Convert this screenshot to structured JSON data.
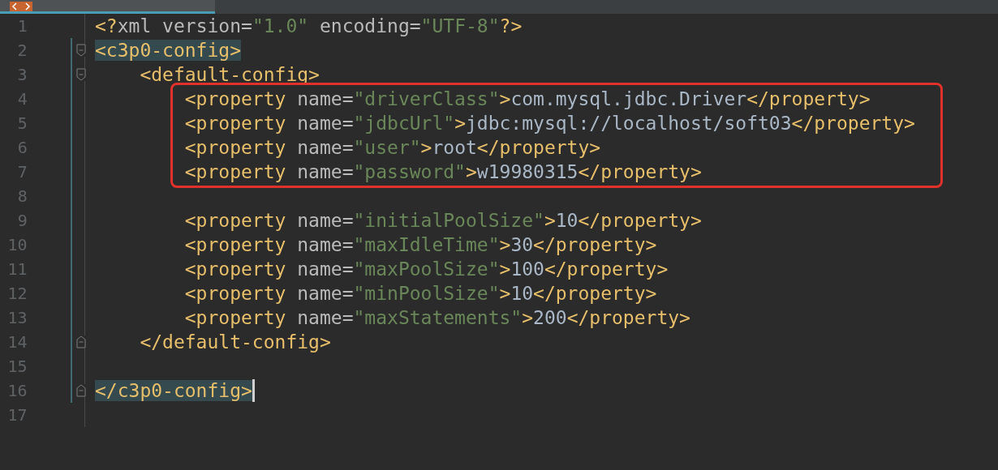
{
  "tab": {
    "selected": true
  },
  "lines": [
    {
      "number": "1",
      "tokens": [
        {
          "kind": "tag",
          "text": "<?"
        },
        {
          "kind": "attr",
          "text": "xml version="
        },
        {
          "kind": "string",
          "text": "\"1.0\""
        },
        {
          "kind": "attr",
          "text": " encoding="
        },
        {
          "kind": "string",
          "text": "\"UTF-8\""
        },
        {
          "kind": "tag",
          "text": "?>"
        }
      ]
    },
    {
      "number": "2",
      "kind": "fold_start",
      "highlighted": true,
      "tokens": [
        {
          "kind": "tag",
          "text": "<c3p0-config>"
        }
      ]
    },
    {
      "number": "3",
      "kind": "fold_start",
      "tokens": [
        {
          "kind": "tag",
          "text": "    <default-config>"
        }
      ]
    },
    {
      "number": "4",
      "boxed": true,
      "tokens": [
        {
          "kind": "tag",
          "text": "        <property"
        },
        {
          "kind": "attr",
          "text": " name="
        },
        {
          "kind": "string",
          "text": "\"driverClass\""
        },
        {
          "kind": "tag",
          "text": ">"
        },
        {
          "kind": "text",
          "text": "com.mysql.jdbc.Driver"
        },
        {
          "kind": "tag",
          "text": "</property>"
        }
      ]
    },
    {
      "number": "5",
      "boxed": true,
      "tokens": [
        {
          "kind": "tag",
          "text": "        <property"
        },
        {
          "kind": "attr",
          "text": " name="
        },
        {
          "kind": "string",
          "text": "\"jdbcUrl\""
        },
        {
          "kind": "tag",
          "text": ">"
        },
        {
          "kind": "text",
          "text": "jdbc:mysql://localhost/soft03"
        },
        {
          "kind": "tag",
          "text": "</property>"
        }
      ]
    },
    {
      "number": "6",
      "boxed": true,
      "tokens": [
        {
          "kind": "tag",
          "text": "        <property"
        },
        {
          "kind": "attr",
          "text": " name="
        },
        {
          "kind": "string",
          "text": "\"user\""
        },
        {
          "kind": "tag",
          "text": ">"
        },
        {
          "kind": "text",
          "text": "root"
        },
        {
          "kind": "tag",
          "text": "</property>"
        }
      ]
    },
    {
      "number": "7",
      "boxed": true,
      "tokens": [
        {
          "kind": "tag",
          "text": "        <property"
        },
        {
          "kind": "attr",
          "text": " name="
        },
        {
          "kind": "string",
          "text": "\"password\""
        },
        {
          "kind": "tag",
          "text": ">"
        },
        {
          "kind": "text",
          "text": "w19980315"
        },
        {
          "kind": "tag",
          "text": "</property>"
        }
      ]
    },
    {
      "number": "8"
    },
    {
      "number": "9",
      "tokens": [
        {
          "kind": "tag",
          "text": "        <property"
        },
        {
          "kind": "attr",
          "text": " name="
        },
        {
          "kind": "string",
          "text": "\"initialPoolSize\""
        },
        {
          "kind": "tag",
          "text": ">"
        },
        {
          "kind": "text",
          "text": "10"
        },
        {
          "kind": "tag",
          "text": "</property>"
        }
      ]
    },
    {
      "number": "10",
      "tokens": [
        {
          "kind": "tag",
          "text": "        <property"
        },
        {
          "kind": "attr",
          "text": " name="
        },
        {
          "kind": "string",
          "text": "\"maxIdleTime\""
        },
        {
          "kind": "tag",
          "text": ">"
        },
        {
          "kind": "text",
          "text": "30"
        },
        {
          "kind": "tag",
          "text": "</property>"
        }
      ]
    },
    {
      "number": "11",
      "tokens": [
        {
          "kind": "tag",
          "text": "        <property"
        },
        {
          "kind": "attr",
          "text": " name="
        },
        {
          "kind": "string",
          "text": "\"maxPoolSize\""
        },
        {
          "kind": "tag",
          "text": ">"
        },
        {
          "kind": "text",
          "text": "100"
        },
        {
          "kind": "tag",
          "text": "</property>"
        }
      ]
    },
    {
      "number": "12",
      "tokens": [
        {
          "kind": "tag",
          "text": "        <property"
        },
        {
          "kind": "attr",
          "text": " name="
        },
        {
          "kind": "string",
          "text": "\"minPoolSize\""
        },
        {
          "kind": "tag",
          "text": ">"
        },
        {
          "kind": "text",
          "text": "10"
        },
        {
          "kind": "tag",
          "text": "</property>"
        }
      ]
    },
    {
      "number": "13",
      "tokens": [
        {
          "kind": "tag",
          "text": "        <property"
        },
        {
          "kind": "attr",
          "text": " name="
        },
        {
          "kind": "string",
          "text": "\"maxStatements\""
        },
        {
          "kind": "tag",
          "text": ">"
        },
        {
          "kind": "text",
          "text": "200"
        },
        {
          "kind": "tag",
          "text": "</property>"
        }
      ]
    },
    {
      "number": "14",
      "kind": "fold_end",
      "tokens": [
        {
          "kind": "tag",
          "text": "    </default-config>"
        }
      ]
    },
    {
      "number": "15"
    },
    {
      "number": "16",
      "kind": "fold_end",
      "highlighted": true,
      "caret": true,
      "tokens": [
        {
          "kind": "tag",
          "text": "</c3p0-config>"
        }
      ]
    },
    {
      "number": "17"
    }
  ]
}
